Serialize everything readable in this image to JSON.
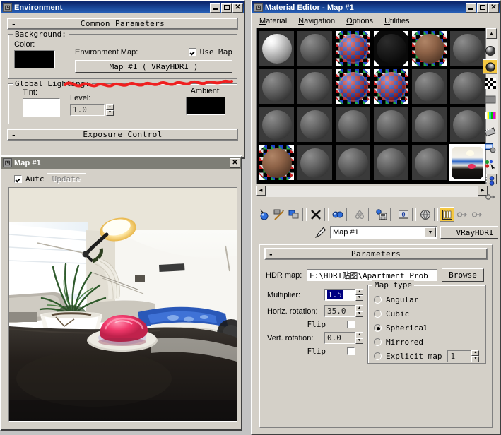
{
  "environment_window": {
    "title": "Environment",
    "icon": "3dsmax-app-icon",
    "buttons": {
      "minimize": "_",
      "maximize": "□",
      "close": "✕"
    },
    "rollups": [
      {
        "label": "Common Parameters",
        "toggle": "-"
      },
      {
        "label": "Exposure Control",
        "toggle": "-"
      }
    ],
    "background_group": {
      "label": "Background:",
      "color_label": "Color:",
      "color_value": "#000000",
      "env_map_label": "Environment Map:",
      "use_map_label": "Use Map",
      "use_map_checked": true,
      "map_button": "Map #1    ( VRayHDRI )"
    },
    "global_lighting_group": {
      "label": "Global Lighting:",
      "tint_label": "Tint:",
      "tint_value": "#ffffff",
      "level_label": "Level:",
      "level_value": "1.0",
      "ambient_label": "Ambient:",
      "ambient_value": "#000000"
    },
    "annotation": {
      "type": "red-squiggle-underline",
      "color": "#ef2020"
    }
  },
  "map_preview_window": {
    "title": "Map #1",
    "icon": "3dsmax-app-icon",
    "close_button": "✕",
    "auto_label": "Autc",
    "auto_checked": true,
    "update_button": "Update",
    "preview_alt": "HDRI panorama of an apartment interior: dark table with a plate holding a pink object, a white bowl with a potted palm, a bright desk lamp on the ceiling, a window with daylight and a blue sofa"
  },
  "material_editor": {
    "title": "Material Editor - Map #1",
    "icon": "3dsmax-app-icon",
    "buttons": {
      "minimize": "_",
      "maximize": "□",
      "close": "✕"
    },
    "menu": [
      {
        "label": "Material",
        "accel": "M"
      },
      {
        "label": "Navigation",
        "accel": "N"
      },
      {
        "label": "Options",
        "accel": "O"
      },
      {
        "label": "Utilities",
        "accel": "U"
      }
    ],
    "slots": {
      "columns": 6,
      "rows": 4,
      "selected_index": 23,
      "cells": [
        {
          "style": "bright"
        },
        {
          "style": "plain"
        },
        {
          "style": "checker"
        },
        {
          "style": "dark"
        },
        {
          "style": "checker-brown"
        },
        {
          "style": "plain"
        },
        {
          "style": "plain"
        },
        {
          "style": "plain"
        },
        {
          "style": "checker"
        },
        {
          "style": "checker"
        },
        {
          "style": "plain"
        },
        {
          "style": "plain"
        },
        {
          "style": "plain"
        },
        {
          "style": "plain"
        },
        {
          "style": "plain"
        },
        {
          "style": "plain"
        },
        {
          "style": "plain"
        },
        {
          "style": "plain"
        },
        {
          "style": "checker-brown"
        },
        {
          "style": "plain"
        },
        {
          "style": "plain"
        },
        {
          "style": "plain"
        },
        {
          "style": "plain"
        },
        {
          "style": "hdri-preview"
        }
      ]
    },
    "vertical_toolbar": [
      {
        "name": "sample-type-sphere-icon",
        "active": false
      },
      {
        "name": "backlight-icon",
        "active": true
      },
      {
        "name": "background-checker-icon",
        "active": false
      },
      {
        "name": "sample-uv-tiling-icon",
        "active": false
      },
      {
        "name": "video-color-check-icon",
        "active": false
      },
      {
        "name": "make-preview-icon",
        "active": false
      },
      {
        "name": "options-icon",
        "active": false
      },
      {
        "name": "select-by-material-icon",
        "active": false
      },
      {
        "name": "material-id-channel-icon",
        "active": false
      },
      {
        "name": "show-end-result-icon",
        "active": false
      }
    ],
    "horizontal_toolbar": [
      {
        "name": "get-material-icon"
      },
      {
        "name": "put-material-to-scene-icon"
      },
      {
        "name": "assign-material-to-selection-icon"
      },
      {
        "name": "reset-map-icon"
      },
      {
        "name": "make-material-copy-icon"
      },
      {
        "name": "make-unique-icon"
      },
      {
        "name": "put-to-library-icon"
      },
      {
        "name": "material-effects-channel-icon"
      },
      {
        "name": "show-map-in-viewport-icon"
      },
      {
        "name": "show-end-result-icon",
        "active": true
      },
      {
        "name": "go-to-parent-icon"
      },
      {
        "name": "go-forward-to-sibling-icon"
      }
    ],
    "name_bar": {
      "eyedropper_icon": "pick-material-icon",
      "material_name": "Map #1",
      "dropdown_arrow": "▼",
      "type_button": "VRayHDRI"
    },
    "parameters": {
      "rollup_label": "Parameters",
      "rollup_toggle": "-",
      "hdr_map_label": "HDR map:",
      "hdr_map_value": "F:\\HDRI贴图\\Apartment_Prob",
      "browse_button": "Browse",
      "multiplier_label": "Multiplier:",
      "multiplier_value": "1.5",
      "multiplier_selected": true,
      "horiz_rotation_label": "Horiz. rotation:",
      "horiz_rotation_value": "35.0",
      "horiz_flip_label": "Flip",
      "horiz_flip_checked": false,
      "vert_rotation_label": "Vert. rotation:",
      "vert_rotation_value": "0.0",
      "vert_flip_label": "Flip",
      "vert_flip_checked": false,
      "map_type_group": "Map type",
      "map_type_options": [
        {
          "label": "Angular",
          "selected": false
        },
        {
          "label": "Cubic",
          "selected": false
        },
        {
          "label": "Spherical",
          "selected": true
        },
        {
          "label": "Mirrored",
          "selected": false
        },
        {
          "label": "Explicit map",
          "selected": false
        }
      ],
      "explicit_map_value": "1"
    }
  }
}
